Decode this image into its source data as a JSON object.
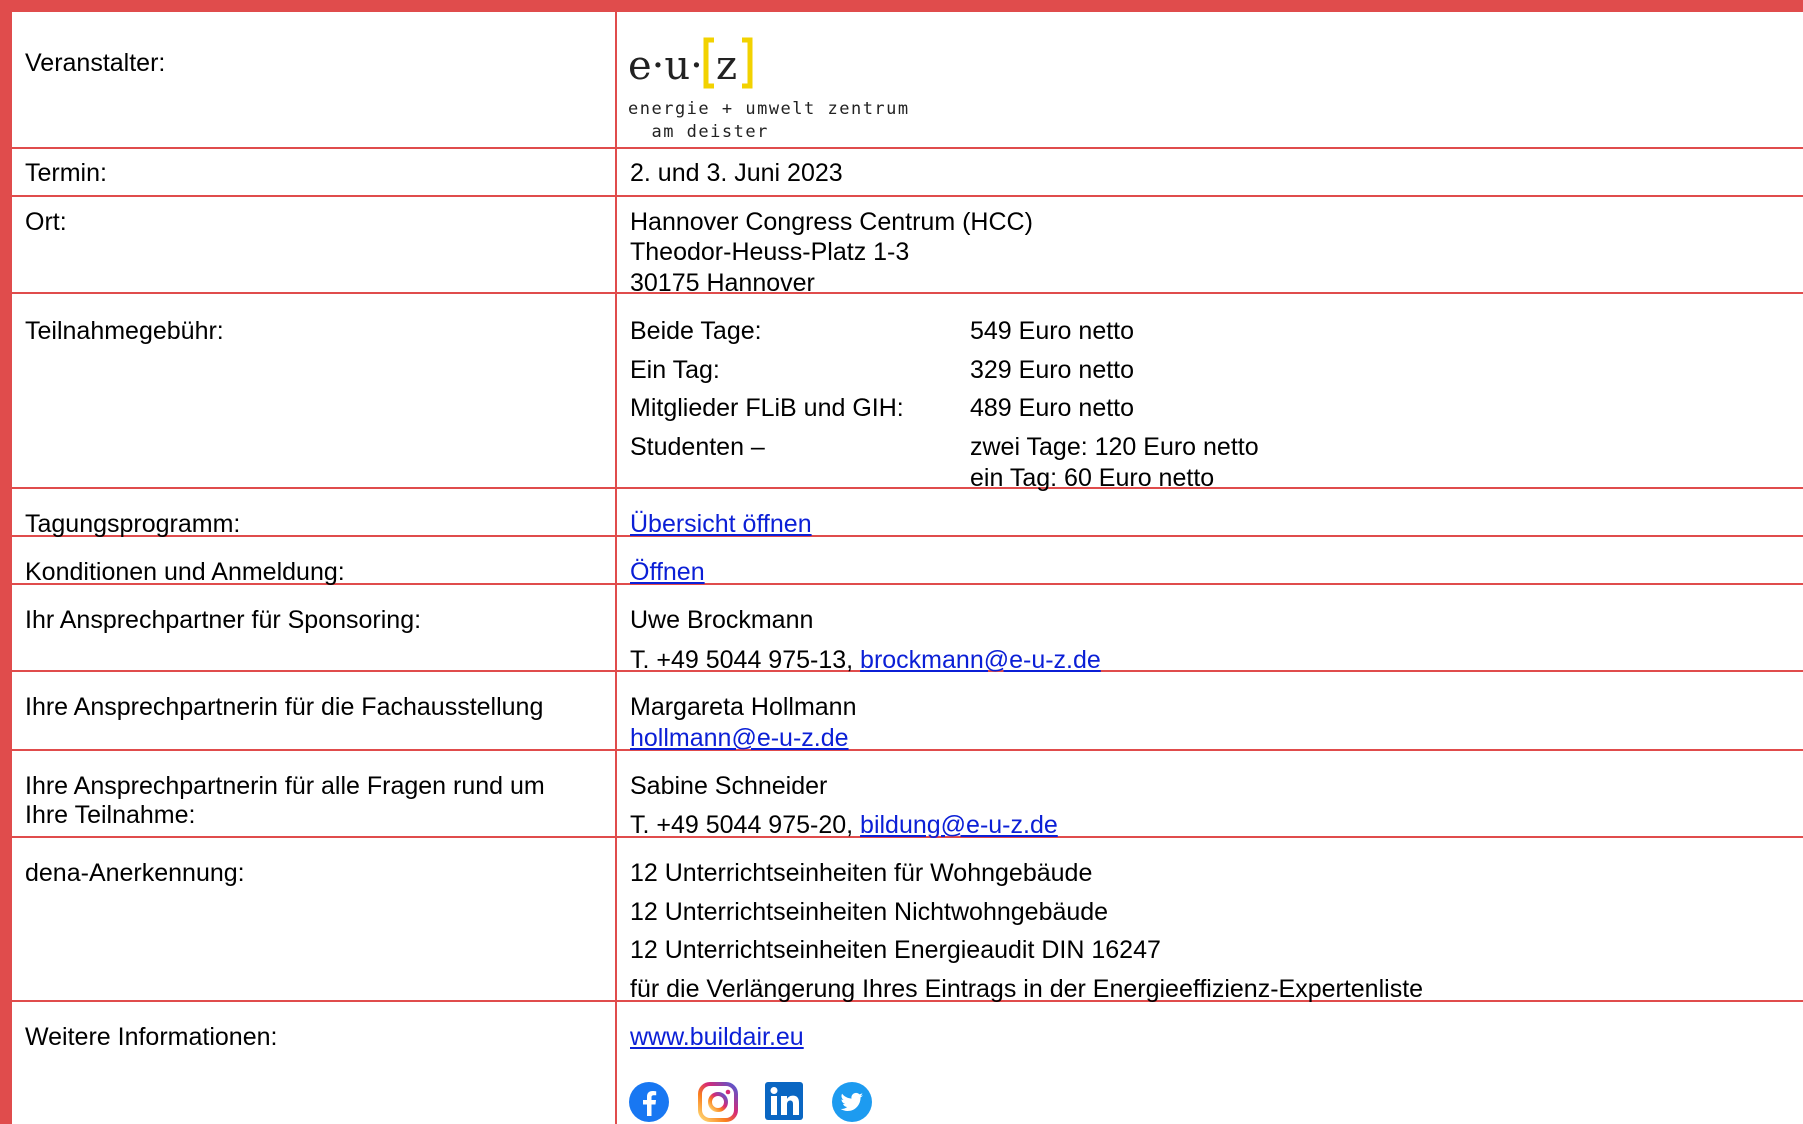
{
  "rows": {
    "veranstalter": {
      "label": "Veranstalter:",
      "logo_letters": "e·u·",
      "logo_z": "z",
      "logo_line1": "energie + umwelt zentrum",
      "logo_line2": "  am deister"
    },
    "termin": {
      "label": "Termin:",
      "value": "2. und 3. Juni 2023"
    },
    "ort": {
      "label": "Ort:",
      "lines": [
        "Hannover Congress Centrum (HCC)",
        "Theodor-Heuss-Platz 1-3",
        "30175 Hannover"
      ]
    },
    "gebuehr": {
      "label": "Teilnahmegebühr:",
      "items": [
        {
          "name": "Beide Tage:",
          "price": "549 Euro netto"
        },
        {
          "name": "Ein Tag:",
          "price": "329 Euro netto"
        },
        {
          "name": "Mitglieder FLiB und GIH:",
          "price": "489 Euro netto"
        },
        {
          "name": "Studenten –",
          "price": "zwei Tage:  120 Euro netto",
          "price2": "ein Tag:  60 Euro netto"
        }
      ]
    },
    "programm": {
      "label": "Tagungsprogramm:",
      "link": "Übersicht öffnen"
    },
    "anmeldung": {
      "label": "Konditionen und Anmeldung:",
      "link": "Öffnen"
    },
    "sponsoring": {
      "label": "Ihr Ansprechpartner für Sponsoring:",
      "name": "Uwe Brockmann",
      "phone": "T. +49 5044 975-13, ",
      "email": "brockmann@e-u-z.de"
    },
    "fachausstellung": {
      "label": "Ihre Ansprechpartnerin für die Fachausstellung",
      "name": "Margareta Hollmann",
      "email": "hollmann@e-u-z.de"
    },
    "teilnahme": {
      "label_line1": "Ihre Ansprechpartnerin für alle Fragen rund um",
      "label_line2": "Ihre Teilnahme:",
      "name": "Sabine Schneider",
      "phone": "T. +49 5044 975-20, ",
      "email": "bildung@e-u-z.de"
    },
    "dena": {
      "label": "dena-Anerkennung:",
      "lines": [
        "12 Unterrichtseinheiten für Wohngebäude",
        "12 Unterrichtseinheiten Nichtwohngebäude",
        "12 Unterrichtseinheiten Energieaudit DIN 16247",
        "für die Verlängerung Ihres Eintrags in der Energieeffizienz-Expertenliste"
      ]
    },
    "info": {
      "label": "Weitere Informationen:",
      "link": "www.buildair.eu"
    }
  },
  "social_icons": [
    "facebook-icon",
    "instagram-icon",
    "linkedin-icon",
    "twitter-icon"
  ],
  "colors": {
    "border": "#e04c4c",
    "link": "#0b1fd6",
    "logo_yellow": "#f2d200"
  }
}
